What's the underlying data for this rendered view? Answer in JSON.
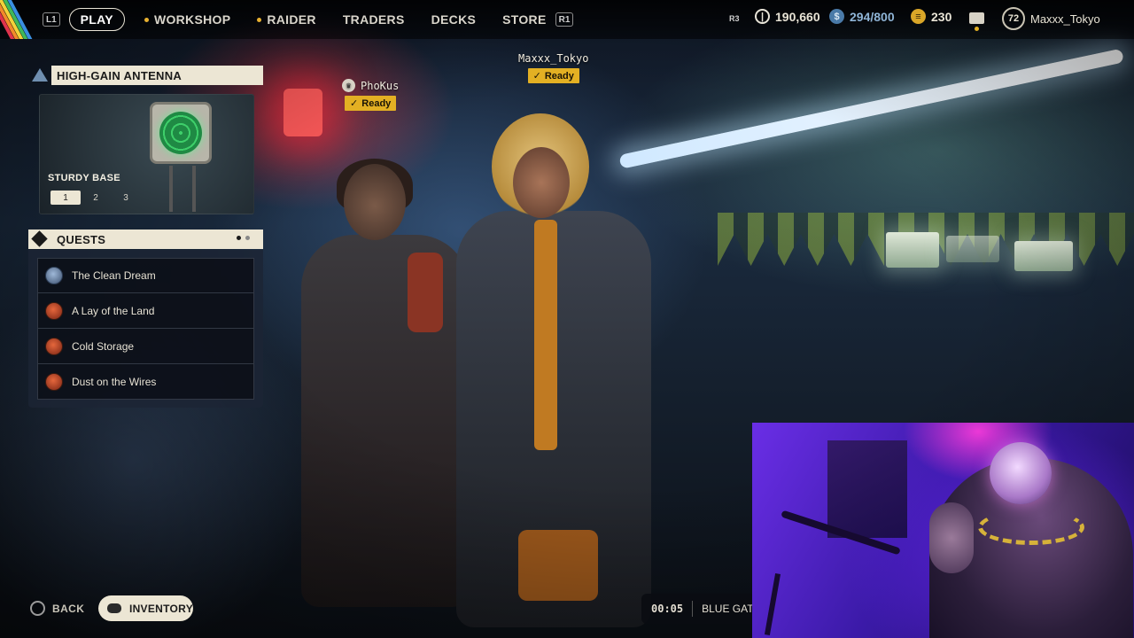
{
  "topbar": {
    "nav": {
      "l1_hint": "L1",
      "play": "PLAY",
      "workshop": "WORKSHOP",
      "raider": "RAIDER",
      "traders": "TRADERS",
      "decks": "DECKS",
      "store": "STORE",
      "r1_hint": "R1"
    },
    "r3_hint": "R3",
    "currencies": {
      "coins": "190,660",
      "credits": "294/800",
      "tokens": "230"
    },
    "profile": {
      "level": "72",
      "username": "Maxxx_Tokyo"
    }
  },
  "workshop_panel": {
    "title": "HIGH-GAIN ANTENNA",
    "subtitle": "STURDY BASE",
    "tiers": [
      "1",
      "2",
      "3"
    ],
    "active_tier": "1"
  },
  "quests": {
    "title": "QUESTS",
    "items": [
      {
        "name": "The Clean Dream",
        "icon": "quest-blue-icon"
      },
      {
        "name": "A Lay of the Land",
        "icon": "quest-red-icon"
      },
      {
        "name": "Cold Storage",
        "icon": "quest-red-icon"
      },
      {
        "name": "Dust on the Wires",
        "icon": "quest-red-icon"
      }
    ]
  },
  "players": [
    {
      "name": "PhoKus",
      "status": "Ready",
      "leader": true
    },
    {
      "name": "Maxxx_Tokyo",
      "status": "Ready",
      "leader": false
    }
  ],
  "bottom": {
    "back_label": "BACK",
    "inventory_label": "INVENTORY",
    "match_timer": "00:05",
    "match_map": "BLUE GATE"
  },
  "colors": {
    "accent_gold": "#e3b023",
    "panel_cream": "#ece6d4",
    "topbar_stripes": [
      "#e0334c",
      "#f28a2a",
      "#f2d23a",
      "#3fb85a",
      "#3a8fe0"
    ]
  }
}
